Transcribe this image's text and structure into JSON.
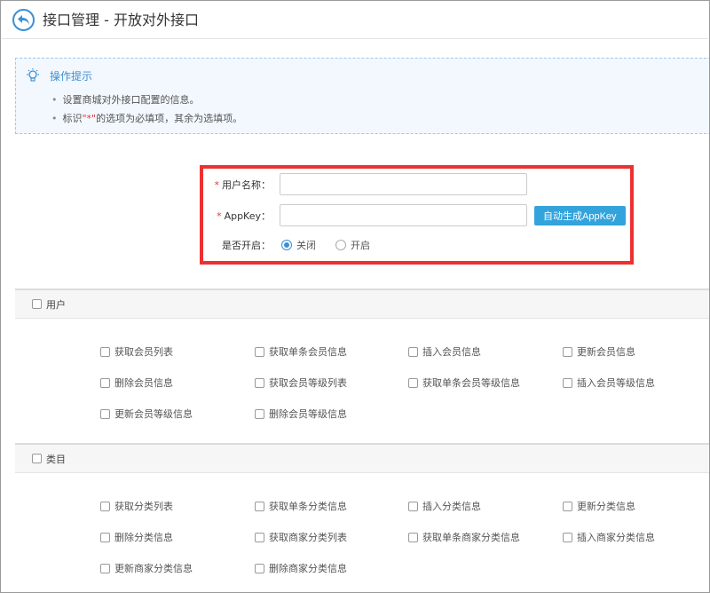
{
  "header": {
    "title": "接口管理 - 开放对外接口"
  },
  "tips": {
    "title": "操作提示",
    "items": [
      "设置商城对外接口配置的信息。"
    ],
    "item2_prefix": "标识",
    "item2_mark": "\"*\"",
    "item2_suffix": "的选项为必填项，其余为选填项。"
  },
  "form": {
    "username_label": "用户名称：",
    "username_value": "",
    "appkey_label": "AppKey：",
    "appkey_value": "",
    "generate_button": "自动生成AppKey",
    "enable_label": "是否开启：",
    "enable_options": [
      "关闭",
      "开启"
    ],
    "enable_selected": "关闭",
    "required_mark": "*"
  },
  "sections": [
    {
      "label": "用户",
      "items": [
        "获取会员列表",
        "获取单条会员信息",
        "插入会员信息",
        "更新会员信息",
        "删除会员信息",
        "获取会员等级列表",
        "获取单条会员等级信息",
        "插入会员等级信息",
        "更新会员等级信息",
        "删除会员等级信息"
      ]
    },
    {
      "label": "类目",
      "items": [
        "获取分类列表",
        "获取单条分类信息",
        "插入分类信息",
        "更新分类信息",
        "删除分类信息",
        "获取商家分类列表",
        "获取单条商家分类信息",
        "插入商家分类信息",
        "更新商家分类信息",
        "删除商家分类信息"
      ]
    }
  ],
  "colors": {
    "accent": "#3a8fd6",
    "button": "#33a3dc",
    "highlight": "#ec3131",
    "required": "#e4393c"
  }
}
